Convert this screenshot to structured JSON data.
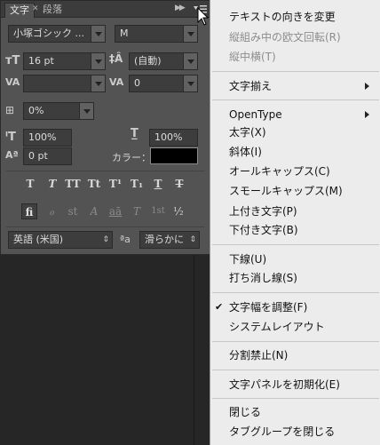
{
  "panel": {
    "tabs": [
      {
        "label": "文字"
      },
      {
        "label": "段落"
      }
    ],
    "font_family": "小塚ゴシック ...",
    "font_style": "M",
    "font_size": "16 pt",
    "leading": "(自動)",
    "kerning": "",
    "tracking": "0",
    "vertical_scale_pct": "0%",
    "scale_v": "100%",
    "scale_h": "100%",
    "baseline_shift": "0 pt",
    "color_label": "カラー：",
    "color_value": "#000000",
    "type_buttons": [
      "T",
      "T",
      "TT",
      "Tt",
      "T¹",
      "T₁",
      "T",
      "T"
    ],
    "opentype_buttons": [
      "fi",
      "ℴ",
      "st",
      "A",
      "aā",
      "T",
      "1st",
      "½"
    ],
    "language": "英語 (米国)",
    "aa_label": "ªa",
    "antialias": "滑らかに"
  },
  "menu": {
    "items": [
      {
        "label": "テキストの向きを変更",
        "disabled": false
      },
      {
        "label": "縦組み中の欧文回転(R)",
        "disabled": true
      },
      {
        "label": "縦中横(T)",
        "disabled": true
      },
      {
        "label": "文字揃え",
        "disabled": false,
        "submenu": true
      },
      {
        "label": "OpenType",
        "disabled": false,
        "submenu": true
      },
      {
        "label": "太字(X)",
        "disabled": false
      },
      {
        "label": "斜体(I)",
        "disabled": false
      },
      {
        "label": "オールキャップス(C)",
        "disabled": false
      },
      {
        "label": "スモールキャップス(M)",
        "disabled": false
      },
      {
        "label": "上付き文字(P)",
        "disabled": false
      },
      {
        "label": "下付き文字(B)",
        "disabled": false
      },
      {
        "label": "下線(U)",
        "disabled": false
      },
      {
        "label": "打ち消し線(S)",
        "disabled": false
      },
      {
        "label": "文字幅を調整(F)",
        "disabled": false,
        "checked": true
      },
      {
        "label": "システムレイアウト",
        "disabled": false
      },
      {
        "label": "分割禁止(N)",
        "disabled": false
      },
      {
        "label": "文字パネルを初期化(E)",
        "disabled": false
      },
      {
        "label": "閉じる",
        "disabled": false
      },
      {
        "label": "タブグループを閉じる",
        "disabled": false
      }
    ]
  }
}
